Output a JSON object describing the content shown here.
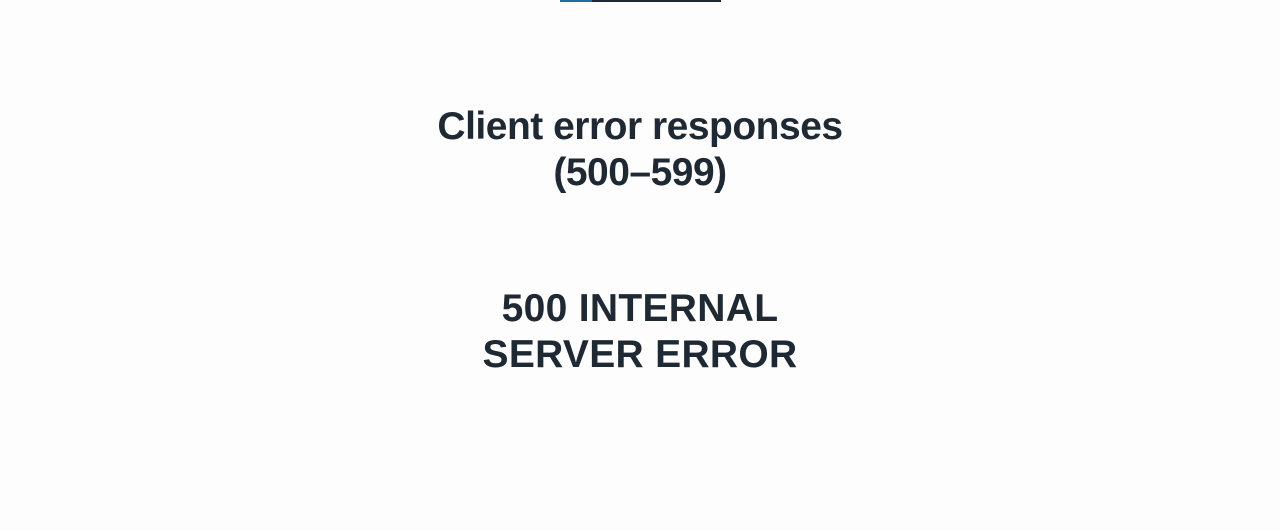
{
  "progress": {
    "value": 0.2,
    "fill_color": "#1d6fa5",
    "track_color": "#1f2933"
  },
  "heading": {
    "line1": "Client error responses",
    "line2": "(500–599)"
  },
  "status": {
    "line1": "500 INTERNAL",
    "line2": "SERVER ERROR"
  }
}
